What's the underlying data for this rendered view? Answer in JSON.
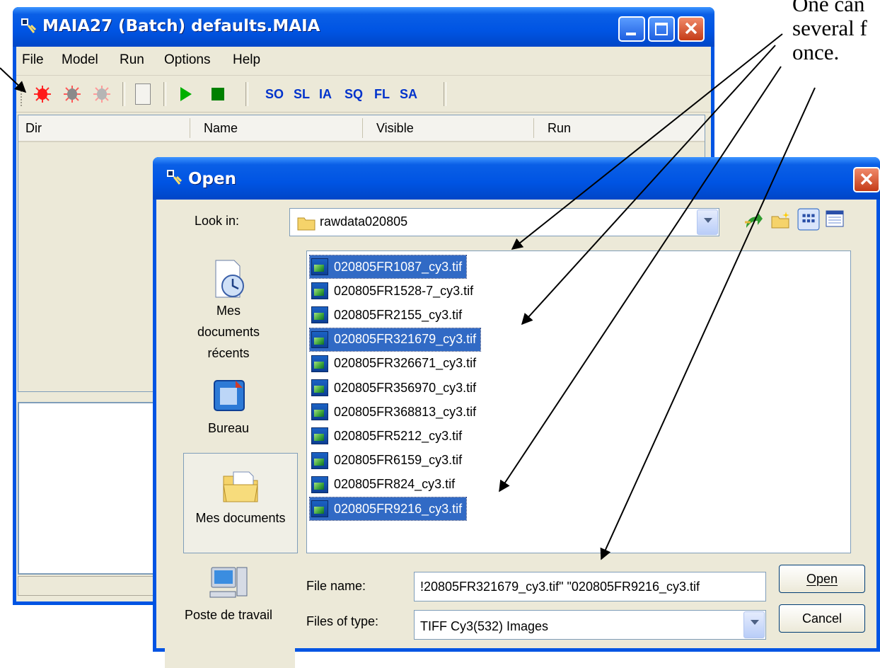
{
  "annotation": {
    "lines": [
      "One can",
      "several f",
      "once."
    ]
  },
  "main_window": {
    "title": "MAIA27 (Batch) defaults.MAIA",
    "menu": [
      "File",
      "Model",
      "Run",
      "Options",
      "Help"
    ],
    "toolbar": {
      "tool_icons": [
        "bug-red-icon",
        "bug-dark-icon",
        "bug-light-icon",
        "blank-button-icon",
        "play-icon",
        "stop-icon"
      ],
      "text_buttons": [
        "SO",
        "SL",
        "IA",
        "SQ",
        "FL",
        "SA"
      ]
    },
    "columns": [
      "Dir",
      "Name",
      "Visible",
      "Run"
    ]
  },
  "open_dialog": {
    "title": "Open",
    "look_in_label": "Look in:",
    "look_in_value": "rawdata020805",
    "places": [
      {
        "label_lines": [
          "Mes",
          "documents",
          "récents"
        ],
        "icon": "recent-documents-icon"
      },
      {
        "label_lines": [
          "Bureau"
        ],
        "icon": "desktop-icon"
      },
      {
        "label_lines": [
          "Mes documents"
        ],
        "icon": "my-documents-icon"
      },
      {
        "label_lines": [
          "Poste de travail"
        ],
        "icon": "my-computer-icon"
      }
    ],
    "files": [
      {
        "name": "020805FR1087_cy3.tif",
        "selected": true
      },
      {
        "name": "020805FR1528-7_cy3.tif",
        "selected": false
      },
      {
        "name": "020805FR2155_cy3.tif",
        "selected": false
      },
      {
        "name": "020805FR321679_cy3.tif",
        "selected": true
      },
      {
        "name": "020805FR326671_cy3.tif",
        "selected": false
      },
      {
        "name": "020805FR356970_cy3.tif",
        "selected": false
      },
      {
        "name": "020805FR368813_cy3.tif",
        "selected": false
      },
      {
        "name": "020805FR5212_cy3.tif",
        "selected": false
      },
      {
        "name": "020805FR6159_cy3.tif",
        "selected": false
      },
      {
        "name": "020805FR824_cy3.tif",
        "selected": false
      },
      {
        "name": "020805FR9216_cy3.tif",
        "selected": true
      }
    ],
    "file_name_label": "File name:",
    "file_name_value": "!20805FR321679_cy3.tif\" \"020805FR9216_cy3.tif",
    "files_of_type_label": "Files of type:",
    "files_of_type_value": "TIFF Cy3(532) Images",
    "open_button": "Open",
    "cancel_button": "Cancel"
  },
  "colors": {
    "title_blue": "#0054e3",
    "selection": "#316ac5",
    "window_face": "#ece9d8",
    "toolbar_text": "#0033cc"
  }
}
